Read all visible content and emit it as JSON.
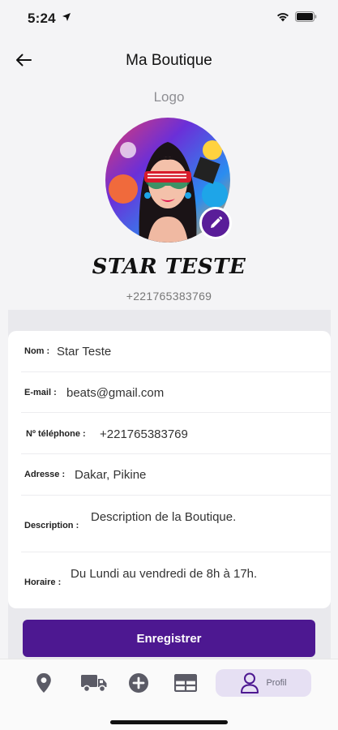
{
  "status": {
    "time": "5:24"
  },
  "header": {
    "title": "Ma Boutique"
  },
  "logo_label": "Logo",
  "profile": {
    "name": "STAR TESTE",
    "phone": "+221765383769"
  },
  "fields": {
    "nom": {
      "label": "Nom :",
      "value": "Star Teste"
    },
    "email": {
      "label": "E-mail :",
      "value": "beats@gmail.com"
    },
    "telephone": {
      "label": "Nº téléphone :",
      "value": "+221765383769"
    },
    "adresse": {
      "label": "Adresse :",
      "value": "Dakar, Pikine"
    },
    "description": {
      "label": "Description :",
      "value": "Description de la Boutique."
    },
    "horaire": {
      "label": "Horaire :",
      "value": "Du Lundi au vendredi de 8h à 17h."
    }
  },
  "save_label": "Enregistrer",
  "tabbar": {
    "active_label": "Profil"
  },
  "colors": {
    "accent": "#4d1891",
    "accent_light": "#e6e0f3",
    "background": "#f4f4f6"
  }
}
